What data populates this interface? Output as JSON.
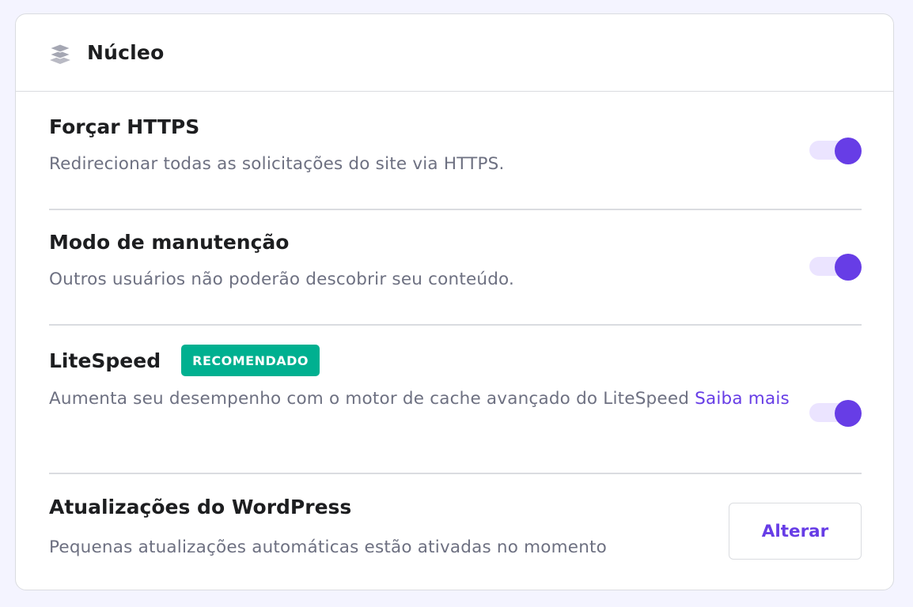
{
  "header": {
    "icon": "layers-icon",
    "title": "Núcleo"
  },
  "settings": [
    {
      "title": "Forçar HTTPS",
      "description": "Redirecionar todas as solicitações do site via HTTPS.",
      "control": "toggle",
      "enabled": true
    },
    {
      "title": "Modo de manutenção",
      "description": "Outros usuários não poderão descobrir seu conteúdo.",
      "control": "toggle",
      "enabled": true
    },
    {
      "title": "LiteSpeed",
      "badge": "RECOMENDADO",
      "description": "Aumenta seu desempenho com o motor de cache avançado do LiteSpeed",
      "link_label": "Saiba mais",
      "control": "toggle",
      "enabled": true
    },
    {
      "title": "Atualizações do WordPress",
      "description": "Pequenas atualizações automáticas estão ativadas no momento",
      "control": "button",
      "button_label": "Alterar"
    }
  ],
  "colors": {
    "accent": "#673de6",
    "toggle_track": "#ebe4ff",
    "badge": "#00b090",
    "page_background": "#f4f4ff"
  }
}
